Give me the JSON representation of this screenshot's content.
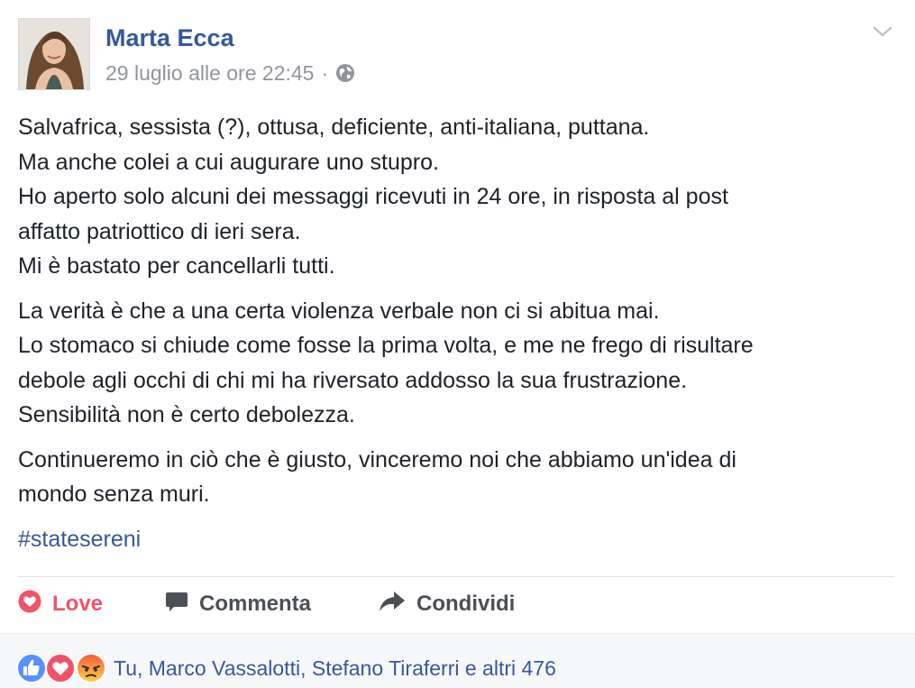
{
  "post": {
    "author": "Marta Ecca",
    "timestamp": "29 luglio alle ore 22:45",
    "separator": "·",
    "privacy_icon": "globe-icon",
    "menu_icon": "chevron-down-icon",
    "paragraphs": [
      "Salvafrica, sessista (?), ottusa, deficiente, anti-italiana, puttana.\nMa anche colei a cui augurare uno stupro.\nHo aperto solo alcuni dei messaggi ricevuti in 24 ore, in risposta al post\naffatto patriottico di ieri sera.\nMi è bastato per cancellarli tutti.",
      "La verità è che a una certa violenza verbale non ci si abitua mai.\nLo stomaco si chiude come fosse la prima volta, e me ne frego di risultare\ndebole agli occhi di chi mi ha riversato addosso la sua frustrazione.\nSensibilità non è certo debolezza.",
      "Continueremo in ciò che è giusto, vinceremo noi che abbiamo un'idea di\nmondo senza muri."
    ],
    "hashtag": "#statesereni"
  },
  "actions": {
    "love": {
      "label": "Love",
      "icon": "heart-icon",
      "color": "#f25268"
    },
    "comment": {
      "label": "Commenta",
      "icon": "comment-icon"
    },
    "share": {
      "label": "Condividi",
      "icon": "share-arrow-icon"
    }
  },
  "reactions": {
    "icons": [
      "like-icon",
      "love-icon",
      "angry-icon"
    ],
    "summary": "Tu, Marco Vassalotti, Stefano Tiraferri e altri 476"
  },
  "colors": {
    "link_blue": "#365899",
    "love_red": "#f25268",
    "like_blue": "#5890ff",
    "angry_orange": "#f7714b",
    "text": "#1d2129",
    "meta_gray": "#90949c"
  }
}
